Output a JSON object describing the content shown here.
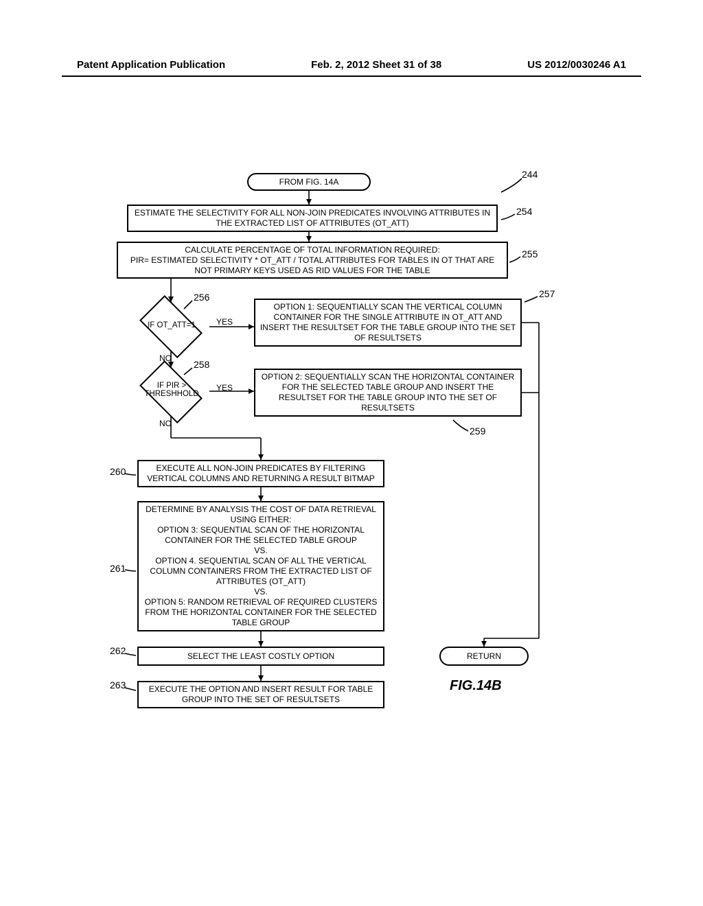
{
  "header": {
    "left": "Patent Application Publication",
    "center": "Feb. 2, 2012  Sheet 31 of 38",
    "right": "US 2012/0030246 A1"
  },
  "connector_from": "FROM FIG. 14A",
  "box254": "ESTIMATE THE SELECTIVITY FOR ALL NON-JOIN PREDICATES INVOLVING ATTRIBUTES IN THE EXTRACTED LIST OF ATTRIBUTES (OT_ATT)",
  "box255": "CALCULATE PERCENTAGE OF TOTAL INFORMATION REQUIRED:\nPIR= ESTIMATED SELECTIVITY * OT_ATT / TOTAL ATTRIBUTES FOR TABLES IN OT THAT ARE NOT PRIMARY KEYS USED AS RID VALUES FOR THE TABLE",
  "decision256": "IF OT_ATT=1",
  "box257": "OPTION 1: SEQUENTIALLY SCAN THE VERTICAL COLUMN CONTAINER FOR THE SINGLE ATTRIBUTE IN OT_ATT AND INSERT THE RESULTSET FOR THE TABLE GROUP INTO THE SET OF RESULTSETS",
  "decision258": "IF PIR > THRESHHOLD",
  "box259": "OPTION 2: SEQUENTIALLY SCAN THE HORIZONTAL CONTAINER FOR THE SELECTED TABLE GROUP AND INSERT THE RESULTSET FOR THE TABLE GROUP INTO THE SET OF RESULTSETS",
  "box260": "EXECUTE ALL NON-JOIN PREDICATES BY FILTERING VERTICAL COLUMNS AND RETURNING A RESULT BITMAP",
  "box261": "DETERMINE BY ANALYSIS THE COST OF DATA RETRIEVAL USING EITHER:\nOPTION 3: SEQUENTIAL SCAN OF THE HORIZONTAL CONTAINER FOR THE SELECTED TABLE GROUP\nVS.\nOPTION 4. SEQUENTIAL SCAN OF ALL THE VERTICAL COLUMN CONTAINERS FROM THE EXTRACTED LIST OF ATTRIBUTES (OT_ATT)\nVS.\nOPTION 5: RANDOM RETRIEVAL OF REQUIRED CLUSTERS FROM THE HORIZONTAL CONTAINER FOR THE SELECTED TABLE GROUP",
  "box262": "SELECT THE LEAST COSTLY OPTION",
  "box263": "EXECUTE THE OPTION AND INSERT RESULT FOR TABLE GROUP INTO THE SET OF RESULTSETS",
  "return_label": "RETURN",
  "yes": "YES",
  "no": "NO",
  "refs": {
    "r244": "244",
    "r254": "254",
    "r255": "255",
    "r256": "256",
    "r257": "257",
    "r258": "258",
    "r259": "259",
    "r260": "260",
    "r261": "261",
    "r262": "262",
    "r263": "263"
  },
  "figure_label": "FIG.14B"
}
